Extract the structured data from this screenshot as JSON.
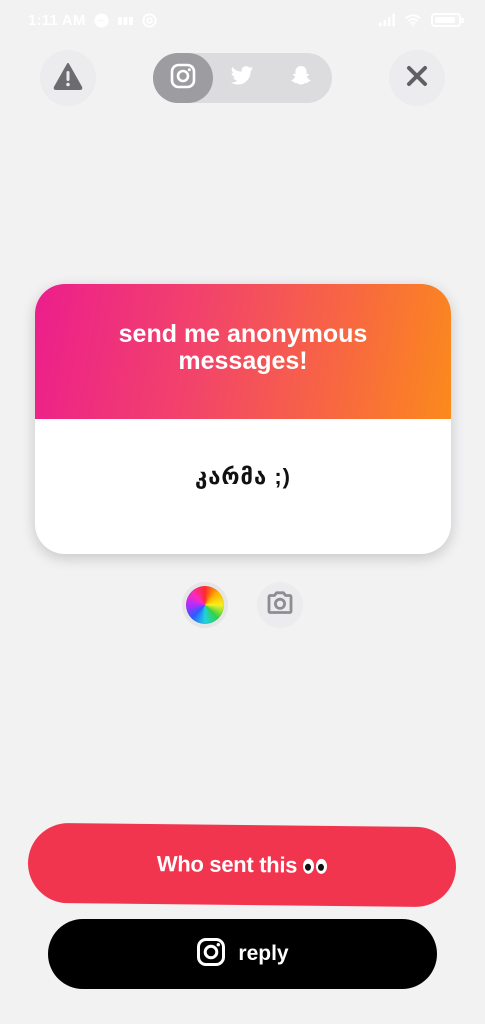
{
  "status_bar": {
    "time": "1:11 AM",
    "left_icons": [
      "messenger-icon",
      "signal-label-icon",
      "at-icon"
    ],
    "right_icons": [
      "cell-signal-icon",
      "wifi-icon",
      "battery-icon"
    ],
    "battery_level": 0.9
  },
  "top_bar": {
    "report_icon": "warning-icon",
    "close_icon": "close-icon",
    "platforms": [
      {
        "name": "instagram",
        "icon": "instagram-icon",
        "active": true
      },
      {
        "name": "twitter",
        "icon": "twitter-icon",
        "active": false
      },
      {
        "name": "snapchat",
        "icon": "snapchat-icon",
        "active": false
      }
    ]
  },
  "card": {
    "title": "send me anonymous messages!",
    "message": "კარმა ;)",
    "gradient_colors": [
      "#ec1e8c",
      "#fb8a1c"
    ]
  },
  "tools": {
    "color_picker_icon": "color-wheel-icon",
    "camera_icon": "camera-icon"
  },
  "actions": {
    "who_sent_label": "Who sent this",
    "who_sent_emoji": "eyes-emoji",
    "reply_label": "reply",
    "reply_icon": "instagram-icon"
  },
  "colors": {
    "background": "#f2f2f3",
    "who_button": "#f2354f",
    "reply_button": "#000000"
  }
}
